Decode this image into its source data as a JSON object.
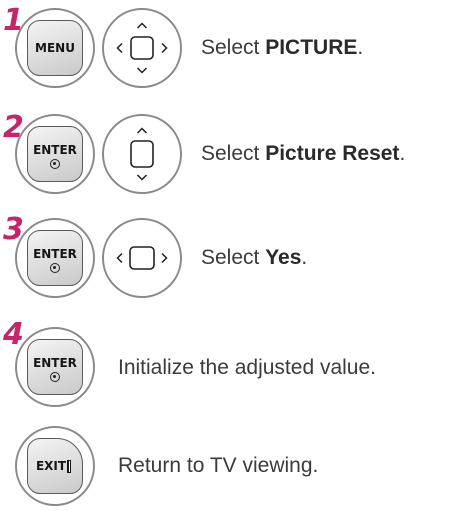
{
  "steps": [
    {
      "number": "1",
      "key": "MENU",
      "text_prefix": "Select ",
      "text_bold": "PICTURE",
      "text_suffix": ".",
      "nav": "4-way"
    },
    {
      "number": "2",
      "key": "ENTER",
      "text_prefix": "Select ",
      "text_bold": "Picture Reset",
      "text_suffix": ".",
      "nav": "up-down"
    },
    {
      "number": "3",
      "key": "ENTER",
      "text_prefix": "Select ",
      "text_bold": "Yes",
      "text_suffix": ".",
      "nav": "left-right"
    },
    {
      "number": "4",
      "key": "ENTER",
      "text": "Initialize the adjusted value."
    },
    {
      "key": "EXIT",
      "text": "Return to TV viewing."
    }
  ],
  "colors": {
    "step_number": "#c8246a",
    "text": "#3b3b3b"
  },
  "icons": [
    "menu-key-icon",
    "enter-key-icon",
    "exit-key-icon",
    "nav-pad-icon"
  ]
}
